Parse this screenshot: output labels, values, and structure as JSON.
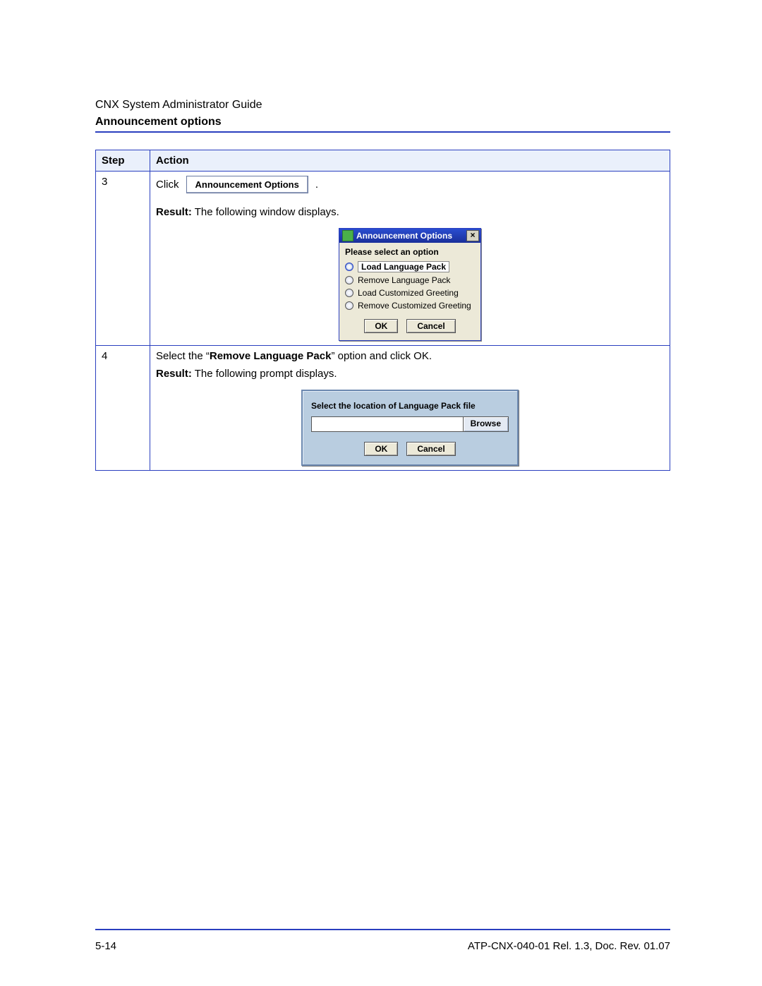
{
  "header": {
    "guide_title": "CNX System Administrator Guide",
    "section_title": "Announcement options"
  },
  "table": {
    "columns": {
      "step": "Step",
      "action": "Action"
    },
    "rows": [
      {
        "step_num": "3",
        "click_text": "Click",
        "click_button_label": "Announcement Options",
        "period": ".",
        "result_label": "Result:",
        "result_text": " The following window displays.",
        "dialog": {
          "title": "Announcement Options",
          "prompt": "Please select an option",
          "options": [
            {
              "label": "Load Language Pack",
              "selected": true
            },
            {
              "label": "Remove Language Pack",
              "selected": false
            },
            {
              "label": "Load Customized Greeting",
              "selected": false
            },
            {
              "label": "Remove Customized Greeting",
              "selected": false
            }
          ],
          "ok": "OK",
          "cancel": "Cancel"
        }
      },
      {
        "step_num": "4",
        "line1_a": "Select the “",
        "line1_bold": "Remove Language Pack",
        "line1_b": "” option and click OK.",
        "result_label": "Result:",
        "result_text": " The following prompt displays.",
        "prompt_dialog": {
          "label": "Select the location of Language Pack file",
          "browse": "Browse",
          "ok": "OK",
          "cancel": "Cancel"
        }
      }
    ]
  },
  "footer": {
    "page_num": "5-14",
    "doc_id": "ATP-CNX-040-01 Rel. 1.3, Doc. Rev. 01.07"
  }
}
